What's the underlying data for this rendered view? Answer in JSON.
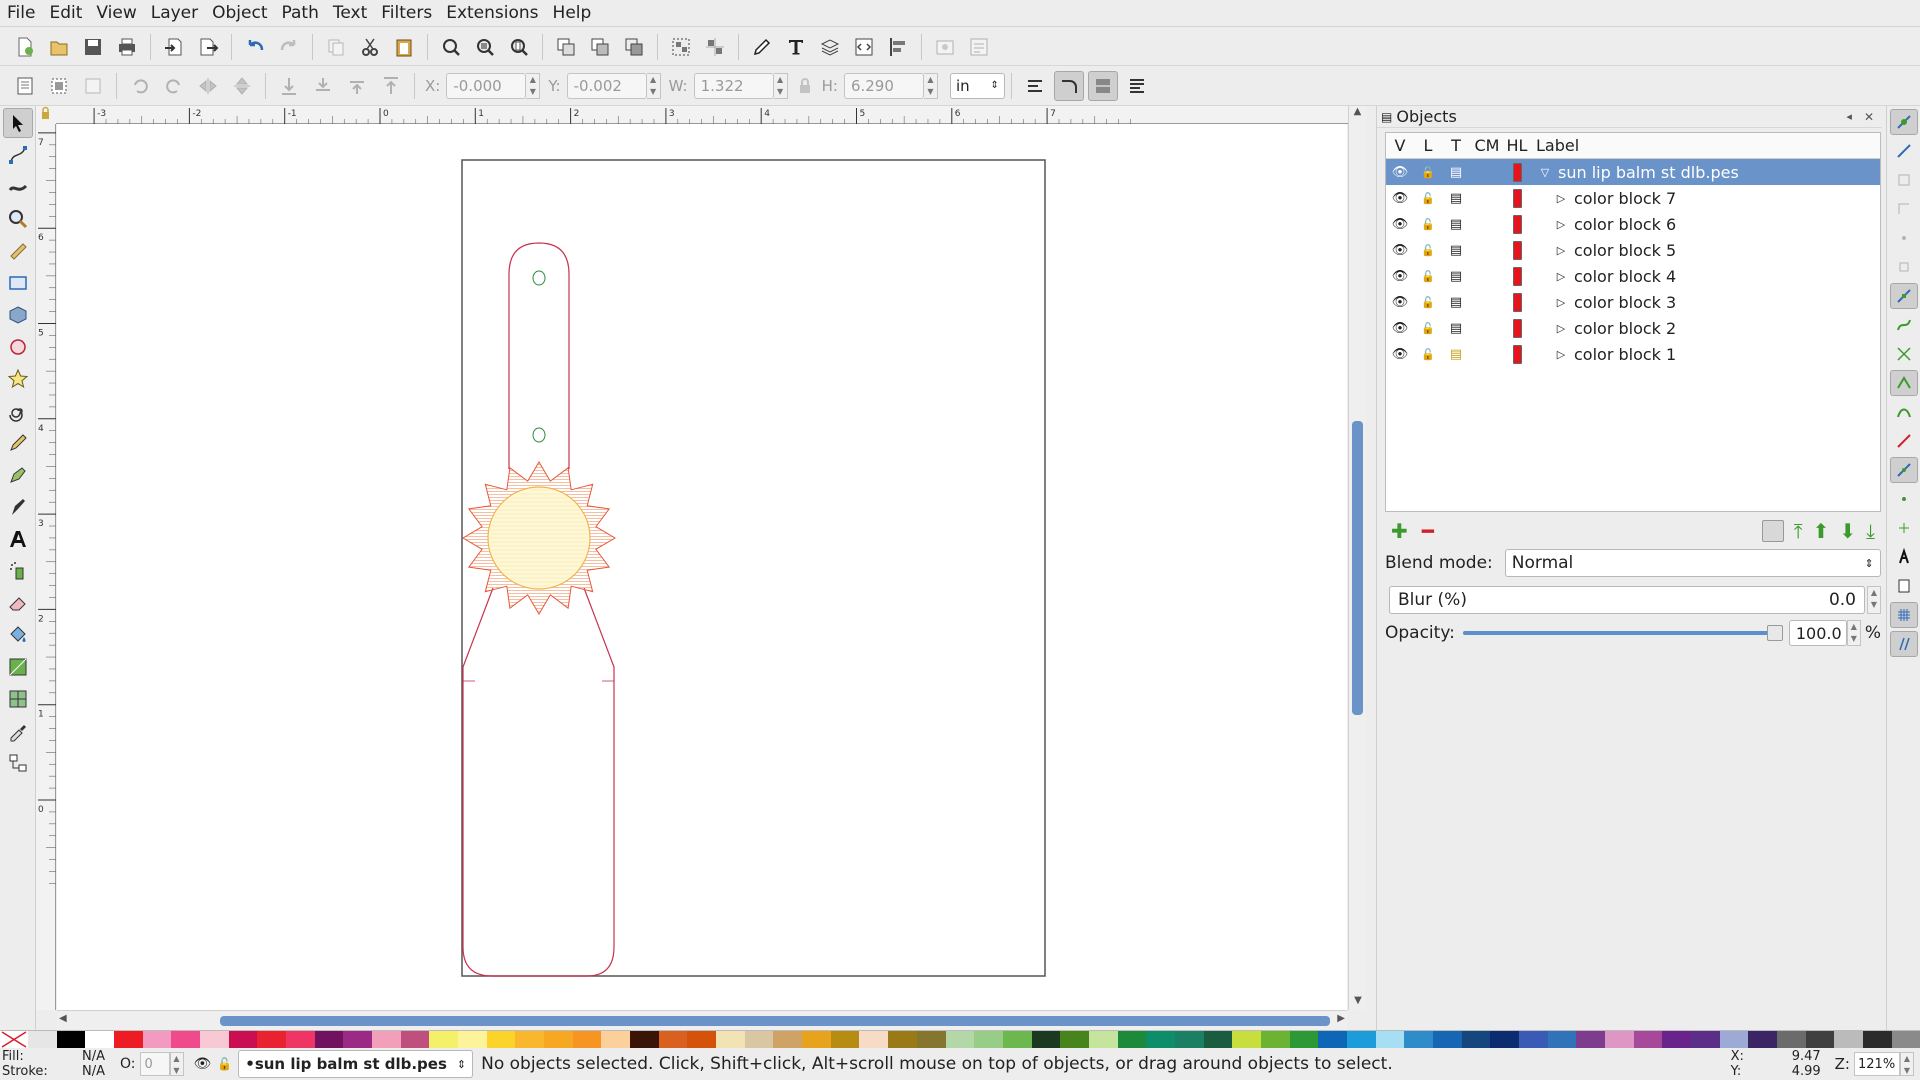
{
  "menu": [
    "File",
    "Edit",
    "View",
    "Layer",
    "Object",
    "Path",
    "Text",
    "Filters",
    "Extensions",
    "Help"
  ],
  "toolbar_controls": {
    "x_label": "X:",
    "x_value": "-0.000",
    "y_label": "Y:",
    "y_value": "-0.002",
    "w_label": "W:",
    "w_value": "1.322",
    "h_label": "H:",
    "h_value": "6.290",
    "unit": "in"
  },
  "rulers": {
    "h_ticks": [
      "-3",
      "-2",
      "-1",
      "0",
      "1",
      "2",
      "3",
      "4",
      "5",
      "6",
      "7"
    ],
    "v_ticks": [
      "7",
      "6",
      "5",
      "4",
      "3",
      "2",
      "1",
      "0"
    ]
  },
  "objects_panel": {
    "title": "Objects",
    "columns": [
      "V",
      "L",
      "T",
      "CM",
      "HL",
      "Label"
    ],
    "rows": [
      {
        "label": "sun lip balm st dlb.pes",
        "expanded": true,
        "selected": true,
        "indent": 0
      },
      {
        "label": "color block 7",
        "expanded": false,
        "selected": false,
        "indent": 1
      },
      {
        "label": "color block 6",
        "expanded": false,
        "selected": false,
        "indent": 1
      },
      {
        "label": "color block 5",
        "expanded": false,
        "selected": false,
        "indent": 1
      },
      {
        "label": "color block 4",
        "expanded": false,
        "selected": false,
        "indent": 1
      },
      {
        "label": "color block 3",
        "expanded": false,
        "selected": false,
        "indent": 1
      },
      {
        "label": "color block 2",
        "expanded": false,
        "selected": false,
        "indent": 1
      },
      {
        "label": "color block 1",
        "expanded": false,
        "selected": false,
        "indent": 1
      }
    ],
    "blend_label": "Blend mode:",
    "blend_value": "Normal",
    "blur_label": "Blur (%)",
    "blur_value": "0.0",
    "opacity_label": "Opacity:",
    "opacity_value": "100.0",
    "opacity_unit": "%",
    "opacity_level": 1.0
  },
  "palette": [
    "#e6e6e6",
    "#000000",
    "#ffffff",
    "#ed1c24",
    "#f39ac0",
    "#ee4a8c",
    "#f9c8d5",
    "#c90f52",
    "#e8232f",
    "#ef3564",
    "#70125f",
    "#9a2a86",
    "#f2a0b9",
    "#bf4f7c",
    "#f4f06a",
    "#fcf39a",
    "#fcd32b",
    "#f9b72e",
    "#f7a823",
    "#f79522",
    "#fcd09a",
    "#3b1408",
    "#d9601f",
    "#d5520b",
    "#f2e3b4",
    "#d9c7a4",
    "#cfa265",
    "#e6a31b",
    "#b68c13",
    "#f6dcc6",
    "#9a7a16",
    "#86752f",
    "#b3d7a7",
    "#98cd87",
    "#6cb84f",
    "#1b3920",
    "#48841c",
    "#c5e49e",
    "#1d8a3b",
    "#0e8d6b",
    "#1b7f63",
    "#1b5c40",
    "#c7de3d",
    "#6db333",
    "#2c9836",
    "#0e66b7",
    "#1c9dd9",
    "#a6def4",
    "#2f8cca",
    "#1666b4",
    "#15467e",
    "#0b2c6f",
    "#3a5bb5",
    "#3073b8",
    "#7e3c8f",
    "#de96c4",
    "#a6499a",
    "#69248b",
    "#5b2e88",
    "#9eaad6",
    "#3c2565",
    "#6b6b6b",
    "#3f3f3f",
    "#bbbbbb",
    "#2b2b2b",
    "#8a8a8a"
  ],
  "status": {
    "fill_label": "Fill:",
    "fill_value": "N/A",
    "stroke_label": "Stroke:",
    "stroke_value": "N/A",
    "opacity_label": "O:",
    "opacity_value": "0",
    "layer": "•sun lip balm st dlb.pes",
    "message": "No objects selected. Click, Shift+click, Alt+scroll mouse on top of objects, or drag around objects to select.",
    "x_label": "X:",
    "x_value": "9.47",
    "y_label": "Y:",
    "y_value": "4.99",
    "zoom_label": "Z:",
    "zoom_value": "121%"
  }
}
